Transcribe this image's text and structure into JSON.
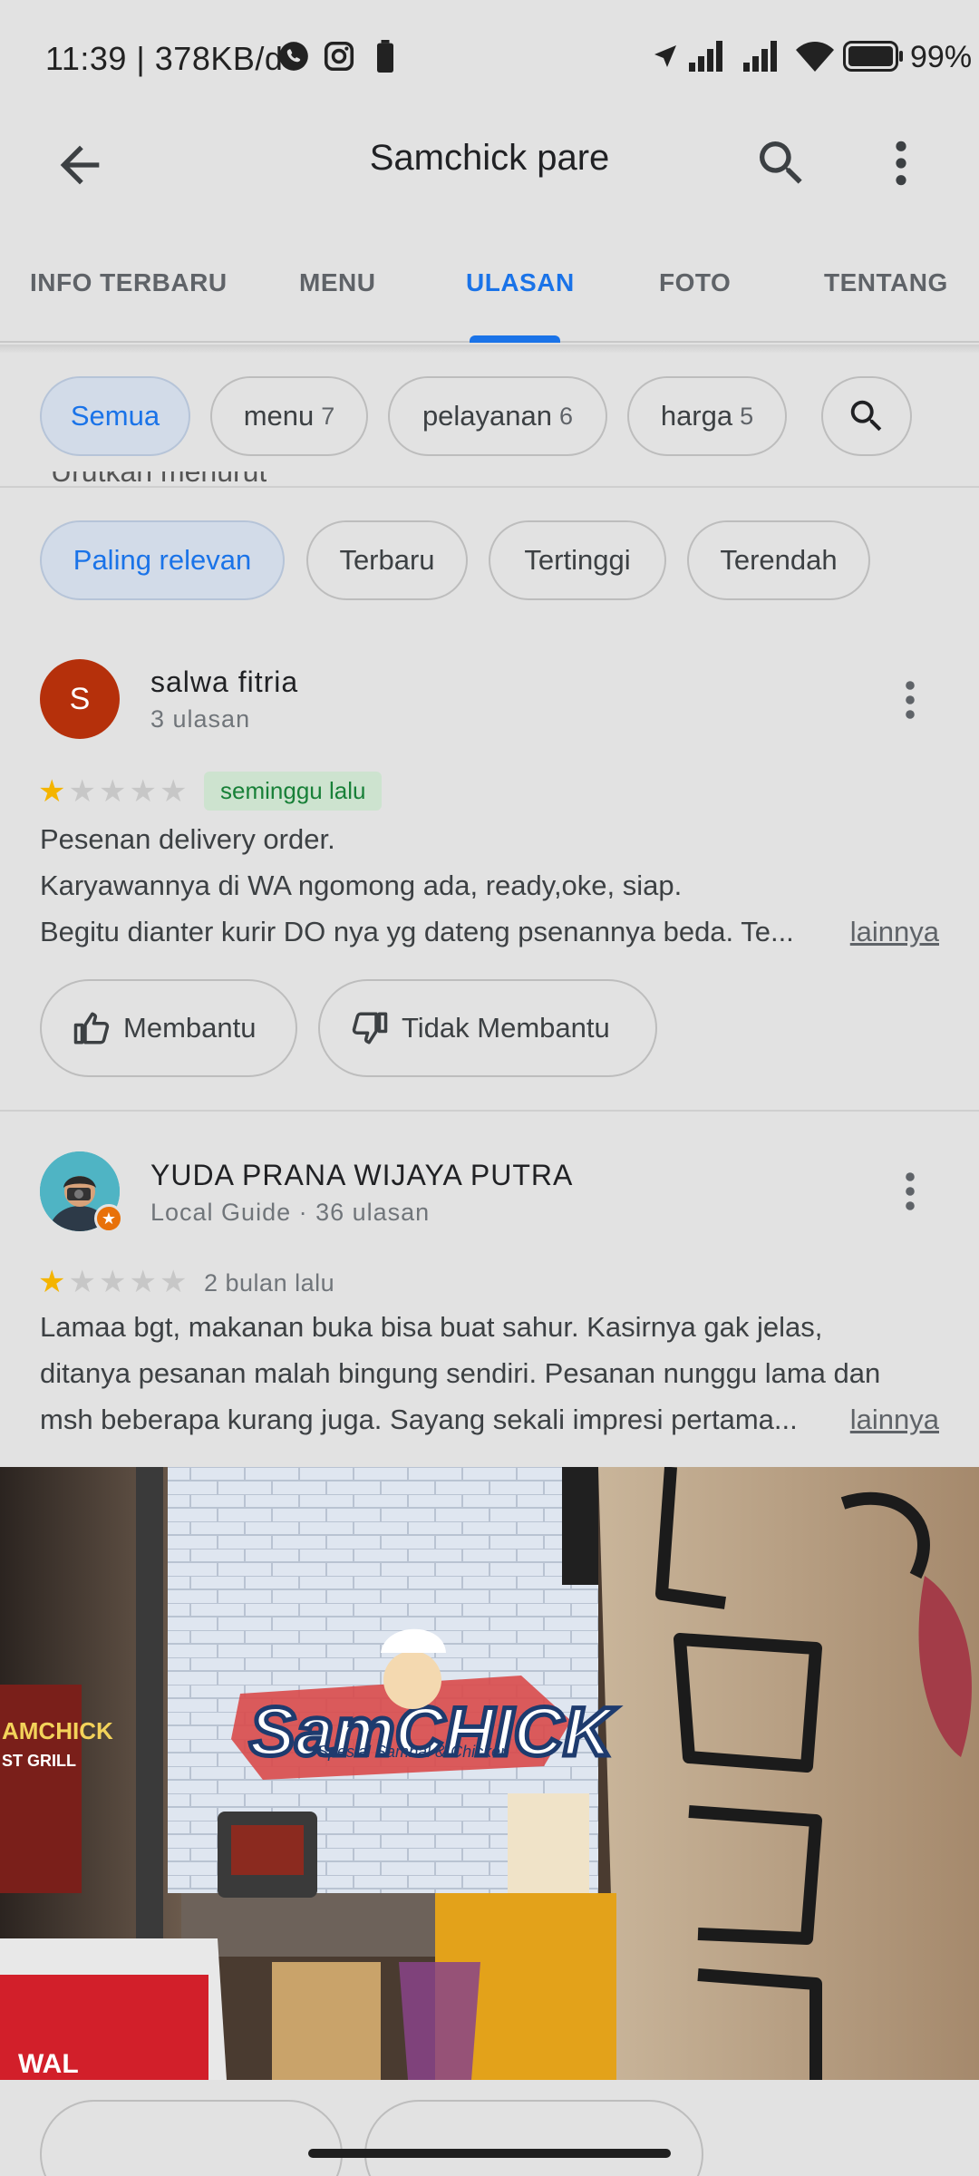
{
  "status_bar": {
    "time_speed": "11:39 | 378KB/d",
    "battery": "99%"
  },
  "app_bar": {
    "title": "Samchick pare"
  },
  "tabs": [
    {
      "label": "INFO TERBARU",
      "active": false
    },
    {
      "label": "MENU",
      "active": false
    },
    {
      "label": "ULASAN",
      "active": true
    },
    {
      "label": "FOTO",
      "active": false
    },
    {
      "label": "TENTANG",
      "active": false
    }
  ],
  "filter_chips": [
    {
      "label": "Semua",
      "count": "",
      "selected": true
    },
    {
      "label": "menu",
      "count": "7",
      "selected": false
    },
    {
      "label": "pelayanan",
      "count": "6",
      "selected": false
    },
    {
      "label": "harga",
      "count": "5",
      "selected": false
    }
  ],
  "sort": {
    "heading_partial": "Urutkan menurut",
    "options": [
      {
        "label": "Paling relevan",
        "selected": true
      },
      {
        "label": "Terbaru",
        "selected": false
      },
      {
        "label": "Tertinggi",
        "selected": false
      },
      {
        "label": "Terendah",
        "selected": false
      }
    ]
  },
  "reviews": [
    {
      "avatar_letter": "S",
      "avatar_color": "#b5300b",
      "name": "salwa fitria",
      "meta": "3 ulasan",
      "rating": 1,
      "date": "seminggu lalu",
      "date_highlight": true,
      "lines": [
        "Pesenan delivery order.",
        "Karyawannya di WA ngomong ada, ready,oke, siap.",
        "Begitu dianter kurir DO nya yg dateng psenannya beda. Te..."
      ],
      "more_label": "lainnya",
      "helpful_label": "Membantu",
      "not_helpful_label": "Tidak Membantu"
    },
    {
      "name": "YUDA PRANA WIJAYA PUTRA",
      "meta": "Local Guide · 36 ulasan",
      "rating": 1,
      "date": "2 bulan lalu",
      "date_highlight": false,
      "lines": [
        "Lamaa bgt, makanan buka bisa buat sahur. Kasirnya gak jelas,",
        "ditanya pesanan malah bingung sendiri. Pesanan nunggu lama dan",
        "msh beberapa kurang juga. Sayang sekali impresi pertama..."
      ],
      "more_label": "lainnya"
    }
  ],
  "photo": {
    "logo_text": "SamCHICK",
    "logo_tagline": "Spesial Sambal & Chicken",
    "left_sign": "AMCHICK",
    "left_sign_sub": "ST GRILL",
    "fridge_brand": "WAL"
  },
  "colors": {
    "accent": "#1a73e8",
    "star": "#f4b400",
    "badge_green": "#188038"
  }
}
